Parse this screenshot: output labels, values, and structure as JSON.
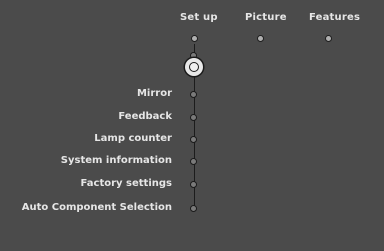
{
  "menu": {
    "tabs": [
      {
        "label": "Set up"
      },
      {
        "label": "Picture"
      },
      {
        "label": "Features"
      }
    ],
    "items": [
      {
        "label": "Mirror"
      },
      {
        "label": "Feedback"
      },
      {
        "label": "Lamp counter"
      },
      {
        "label": "System information"
      },
      {
        "label": "Factory settings"
      },
      {
        "label": "Auto Component Selection"
      }
    ]
  },
  "colors": {
    "background": "#4b4b4b",
    "text": "#e6e6e6"
  }
}
